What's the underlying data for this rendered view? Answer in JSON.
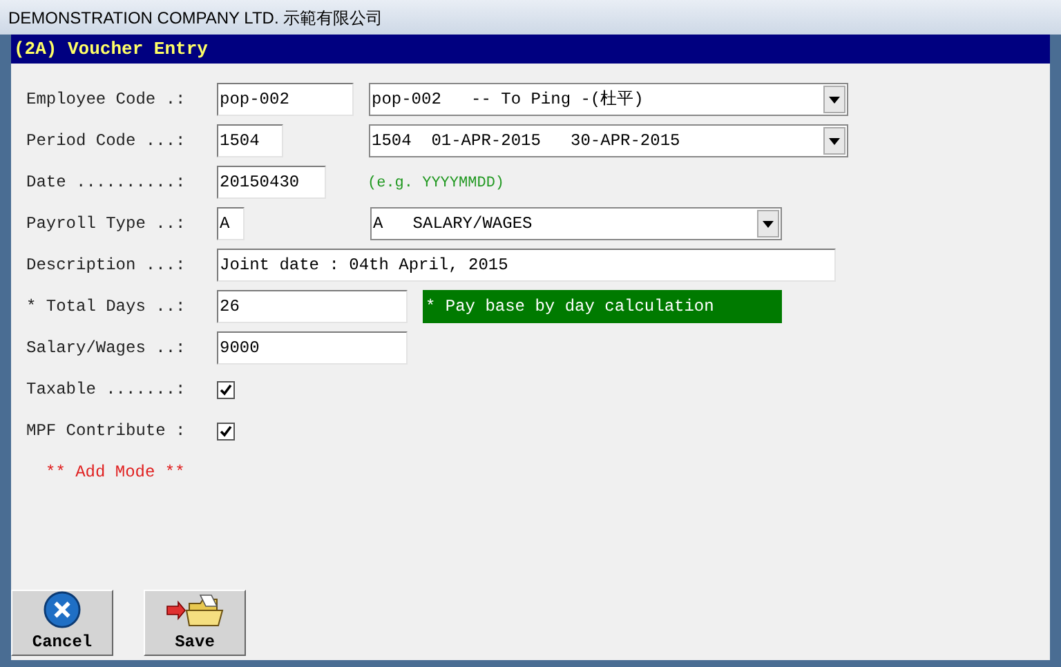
{
  "window": {
    "title": "DEMONSTRATION COMPANY LTD. 示範有限公司"
  },
  "form_title": "(2A) Voucher Entry",
  "rows": [
    {
      "kind": "combo",
      "label": "Employee Code .:",
      "value": "pop-002",
      "combo_value": "pop-002   -- To Ping -(杜平)"
    },
    {
      "kind": "combo",
      "label": "Period Code ...:",
      "value": "1504",
      "combo_value": "1504  01-APR-2015   30-APR-2015"
    },
    {
      "kind": "hint",
      "label": "Date ..........:",
      "value": "20150430",
      "hint": "(e.g. YYYYMMDD)"
    },
    {
      "kind": "combo",
      "label": "Payroll Type ..:",
      "value": "A",
      "combo_value": "A   SALARY/WAGES"
    },
    {
      "kind": "text",
      "label": "Description ...:",
      "value": "Joint date : 04th April, 2015"
    },
    {
      "kind": "note",
      "label": "* Total Days ..:",
      "value": "26",
      "note": "* Pay base by day calculation"
    },
    {
      "kind": "text",
      "label": "Salary/Wages ..:",
      "value": "9000"
    },
    {
      "kind": "check",
      "label": "Taxable .......:",
      "checked": true
    },
    {
      "kind": "check",
      "label": "MPF Contribute :",
      "checked": true
    }
  ],
  "mode": "** Add Mode **",
  "buttons": [
    {
      "kind": "cancel",
      "label": "Cancel"
    },
    {
      "kind": "save",
      "label": "Save"
    }
  ]
}
